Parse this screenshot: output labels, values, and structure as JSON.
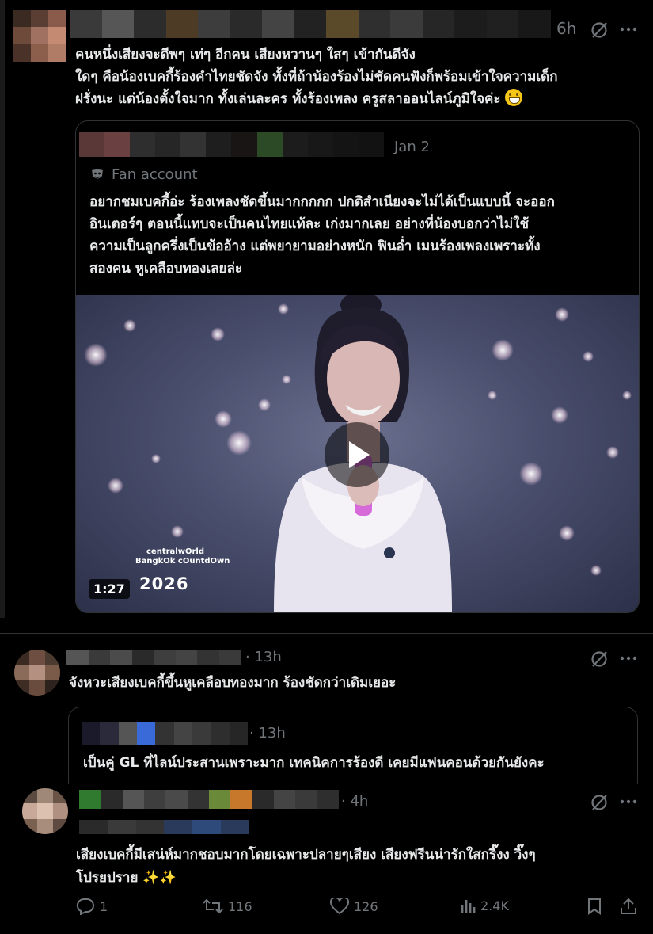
{
  "post": {
    "time": "6h",
    "body_lines": [
      "คนหนึ่งเสียงจะดีพๆ เท่ๆ อีกคน เสียงหวานๆ ใสๆ เข้ากันดีจัง",
      "ใดๆ คือน้องเบคกี้ร้องคำไทยชัดจัง ทั้งที่ถ้าน้องร้องไม่ชัดคนฟังก็พร้อมเข้าใจความเด็ก",
      "ฝรั่งนะ แต่น้องตั้งใจมาก ทั้งเล่นละคร ทั้งร้องเพลง ครูสลาออนไลน์ภูมิใจค่ะ"
    ],
    "emoji_icon": "grinning-face-emoji",
    "quote": {
      "date": "Jan 2",
      "badge": "Fan account",
      "badge_icon": "theater-mask-icon",
      "text_lines": [
        "อยากชมเบคกี้อ่ะ ร้องเพลงชัดขึ้นมากกกกก ปกติสำเนียงจะไม่ได้เป็นแบบนี้ จะออก",
        "อินเตอร์ๆ ตอนนี้แทบจะเป็นคนไทยแท้ละ เก่งมากเลย อย่างที่น้องบอกว่าไม่ใช้",
        "ความเป็นลูกครึ่งเป็นข้ออ้าง แต่พยายามอย่างหนัก ฟินอ่ำ เมนร้องเพลงเพราะทั้ง",
        "สองคน หูเคลือบทองเลยล่ะ"
      ],
      "video": {
        "duration": "1:27",
        "brand_line1": "centralwOrld",
        "brand_line2": "BangkOk cOuntdOwn",
        "year": "2026"
      }
    }
  },
  "reply1": {
    "time": "· 13h",
    "body": "จังหวะเสียงเบคกี้ขึ้นหูเคลือบทองมาก ร้องชัดกว่าเดิมเยอะ",
    "quote": {
      "time": "· 13h",
      "text": "เป็นคู่ GL ที่ไลน์ประสานเพราะมาก เทคนิคการร้องดี เคยมีแฟนคอนด้วยกันยังคะ"
    }
  },
  "reply2": {
    "time": "· 4h",
    "body_line1": "เสียงเบคกี้มีเสน่ห์มากชอบมากโดยเฉพาะปลายๆเสียง เสียงฟรีนน่ารักใสกริ๊งง วิ๊งๆ",
    "body_line2": "โปรยปราย",
    "sparkles": "✨✨",
    "actions": {
      "replies": "1",
      "reposts": "116",
      "likes": "126",
      "views": "2.4K"
    }
  },
  "colors": {
    "background": "#000000",
    "text": "#e7e9ea",
    "muted": "#71767b",
    "border": "#2f3336"
  }
}
